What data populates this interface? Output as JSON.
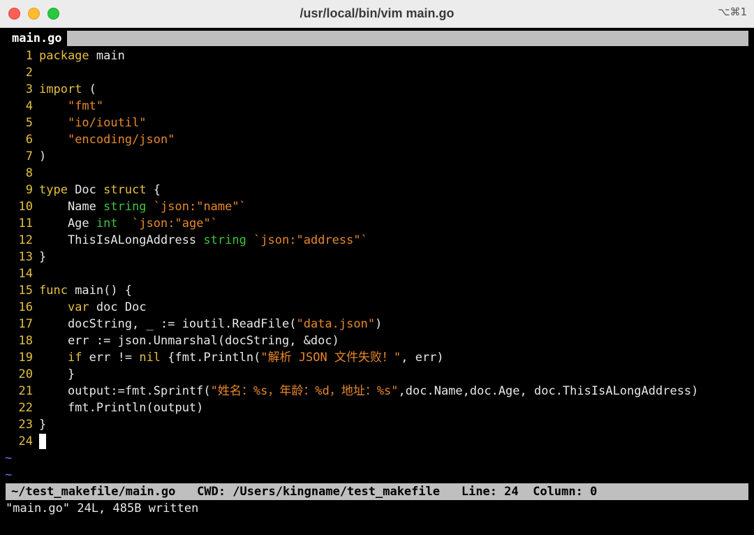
{
  "window": {
    "title": "/usr/local/bin/vim main.go",
    "shortcut": "⌥⌘1"
  },
  "tab": {
    "label": "main.go"
  },
  "colors": {
    "keyword": "#e5c040",
    "type": "#3cc43c",
    "string": "#e7882b",
    "linenumber": "#e5c040",
    "tilde": "#5f7ff6",
    "background": "#000000",
    "statusline_bg": "#bfbfbf"
  },
  "code_lines": [
    {
      "n": "1",
      "tokens": [
        {
          "t": "package",
          "c": "kw"
        },
        {
          "t": " main",
          "c": ""
        }
      ]
    },
    {
      "n": "2",
      "tokens": []
    },
    {
      "n": "3",
      "tokens": [
        {
          "t": "import",
          "c": "kw"
        },
        {
          "t": " (",
          "c": ""
        }
      ]
    },
    {
      "n": "4",
      "tokens": [
        {
          "t": "    ",
          "c": ""
        },
        {
          "t": "\"fmt\"",
          "c": "st"
        }
      ]
    },
    {
      "n": "5",
      "tokens": [
        {
          "t": "    ",
          "c": ""
        },
        {
          "t": "\"io/ioutil\"",
          "c": "st"
        }
      ]
    },
    {
      "n": "6",
      "tokens": [
        {
          "t": "    ",
          "c": ""
        },
        {
          "t": "\"encoding/json\"",
          "c": "st"
        }
      ]
    },
    {
      "n": "7",
      "tokens": [
        {
          "t": ")",
          "c": ""
        }
      ]
    },
    {
      "n": "8",
      "tokens": []
    },
    {
      "n": "9",
      "tokens": [
        {
          "t": "type",
          "c": "kw"
        },
        {
          "t": " Doc ",
          "c": ""
        },
        {
          "t": "struct",
          "c": "kw"
        },
        {
          "t": " {",
          "c": ""
        }
      ]
    },
    {
      "n": "10",
      "tokens": [
        {
          "t": "    Name ",
          "c": ""
        },
        {
          "t": "string",
          "c": "ty"
        },
        {
          "t": " ",
          "c": ""
        },
        {
          "t": "`json:\"name\"`",
          "c": "st"
        }
      ]
    },
    {
      "n": "11",
      "tokens": [
        {
          "t": "    Age ",
          "c": ""
        },
        {
          "t": "int",
          "c": "ty"
        },
        {
          "t": "  ",
          "c": ""
        },
        {
          "t": "`json:\"age\"`",
          "c": "st"
        }
      ]
    },
    {
      "n": "12",
      "tokens": [
        {
          "t": "    ThisIsALongAddress ",
          "c": ""
        },
        {
          "t": "string",
          "c": "ty"
        },
        {
          "t": " ",
          "c": ""
        },
        {
          "t": "`json:\"address\"`",
          "c": "st"
        }
      ]
    },
    {
      "n": "13",
      "tokens": [
        {
          "t": "}",
          "c": ""
        }
      ]
    },
    {
      "n": "14",
      "tokens": []
    },
    {
      "n": "15",
      "tokens": [
        {
          "t": "func",
          "c": "kw"
        },
        {
          "t": " main() {",
          "c": ""
        }
      ]
    },
    {
      "n": "16",
      "tokens": [
        {
          "t": "    ",
          "c": ""
        },
        {
          "t": "var",
          "c": "kw"
        },
        {
          "t": " doc Doc",
          "c": ""
        }
      ]
    },
    {
      "n": "17",
      "tokens": [
        {
          "t": "    docString, _ := ioutil.ReadFile(",
          "c": ""
        },
        {
          "t": "\"data.json\"",
          "c": "st"
        },
        {
          "t": ")",
          "c": ""
        }
      ]
    },
    {
      "n": "18",
      "tokens": [
        {
          "t": "    err := json.Unmarshal(docString, &doc)",
          "c": ""
        }
      ]
    },
    {
      "n": "19",
      "tokens": [
        {
          "t": "    ",
          "c": ""
        },
        {
          "t": "if",
          "c": "kw"
        },
        {
          "t": " err != ",
          "c": ""
        },
        {
          "t": "nil",
          "c": "kw"
        },
        {
          "t": " {fmt.Println(",
          "c": ""
        },
        {
          "t": "\"解析 JSON 文件失败！\"",
          "c": "st"
        },
        {
          "t": ", err)",
          "c": ""
        }
      ]
    },
    {
      "n": "20",
      "tokens": [
        {
          "t": "    }",
          "c": ""
        }
      ]
    },
    {
      "n": "21",
      "tokens": [
        {
          "t": "    output:=fmt.Sprintf(",
          "c": ""
        },
        {
          "t": "\"姓名：%s，年龄：%d，地址：%s\"",
          "c": "st"
        },
        {
          "t": ",doc.Name,doc.Age, doc.ThisIsALongAddress)",
          "c": ""
        }
      ]
    },
    {
      "n": "22",
      "tokens": [
        {
          "t": "    fmt.Println(output)",
          "c": ""
        }
      ]
    },
    {
      "n": "23",
      "tokens": [
        {
          "t": "}",
          "c": ""
        }
      ]
    },
    {
      "n": "24",
      "tokens": [],
      "cursor": true
    }
  ],
  "tildes": [
    "~",
    "~"
  ],
  "statusline": {
    "path": "~/test_makefile/main.go",
    "cwd": "CWD: /Users/kingname/test_makefile",
    "line": "Line: 24",
    "column": "Column: 0"
  },
  "message": "\"main.go\" 24L, 485B written"
}
